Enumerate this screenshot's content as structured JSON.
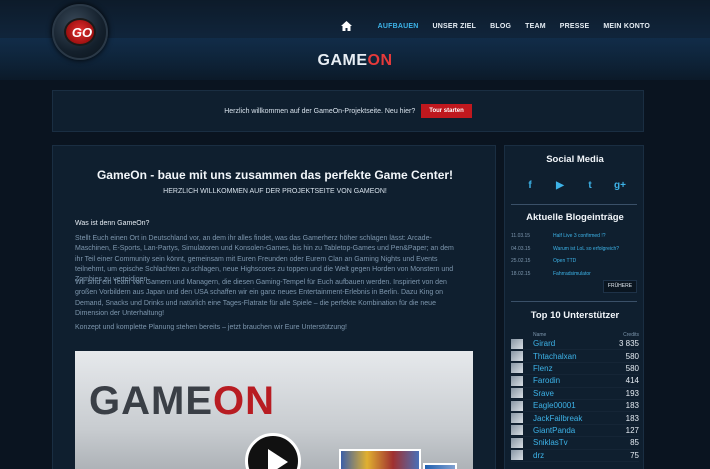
{
  "nav": {
    "items": [
      {
        "label": "AUFBAUEN",
        "active": true
      },
      {
        "label": "UNSER ZIEL",
        "active": false
      },
      {
        "label": "BLOG",
        "active": false
      },
      {
        "label": "TEAM",
        "active": false
      },
      {
        "label": "PRESSE",
        "active": false
      },
      {
        "label": "MEIN KONTO",
        "active": false
      }
    ]
  },
  "brand": {
    "part1": "GAME",
    "part2": "ON"
  },
  "logo": {
    "text": "GO"
  },
  "welcome": {
    "text": "Herzlich willkommen auf der GameOn-Projektseite. Neu hier?",
    "button": "Tour starten"
  },
  "main": {
    "title": "GameOn - baue mit uns zusammen das perfekte Game Center!",
    "subtitle": "HERZLICH WILLKOMMEN AUF DER PROJEKTSEITE VON GAMEON!",
    "section_heading": "Was ist denn GameOn?",
    "paragraphs": [
      "Stellt Euch einen Ort in Deutschland vor, an dem ihr alles findet, was das Gamerherz höher schlagen lässt: Arcade-Maschinen, E-Sports, Lan-Partys, Simulatoren und Konsolen-Games, bis hin zu Tabletop-Games und Pen&Paper; an dem ihr Teil einer Community sein könnt, gemeinsam mit Euren Freunden oder Eurem Clan an Gaming Nights und Events teilnehmt, um epische Schlachten zu schlagen, neue Highscores zu toppen und die Welt gegen Horden von Monstern und Zombies zu verteidigen.",
      "Wir sind ein Team von Gamern und Managern, die diesen Gaming-Tempel für Euch aufbauen werden. Inspiriert von den großen Vorbildern aus Japan und den USA schaffen wir ein ganz neues Entertainment-Erlebnis in Berlin. Dazu King on Demand, Snacks und Drinks und natürlich eine Tages-Flatrate für alle Spiele – die perfekte Kombination für die neue Dimension der Unterhaltung!",
      "Konzept und komplette Planung stehen bereits – jetzt brauchen wir Eure Unterstützung!"
    ],
    "video_logo": {
      "part1": "GAME",
      "part2": "ON"
    }
  },
  "sidebar": {
    "social_title": "Social Media",
    "social": [
      {
        "icon": "facebook-icon",
        "glyph": "f"
      },
      {
        "icon": "youtube-icon",
        "glyph": "▶"
      },
      {
        "icon": "twitter-icon",
        "glyph": "t"
      },
      {
        "icon": "google-plus-icon",
        "glyph": "g+"
      }
    ],
    "blog_title": "Aktuelle Blogeinträge",
    "blog": [
      {
        "date": "11.03.15",
        "title": "Half Live 3 confirmed !?"
      },
      {
        "date": "04.03.15",
        "title": "Warum ist LoL so erfolgreich?"
      },
      {
        "date": "25.02.15",
        "title": "Open TTD"
      },
      {
        "date": "18.02.15",
        "title": "Fahrradsimulator"
      }
    ],
    "older_button": "FRÜHERE",
    "top_title": "Top 10 Unterstützer",
    "top_header_name": "Name",
    "top_header_credits": "Credits",
    "top": [
      {
        "name": "Girard",
        "credits": "3 835"
      },
      {
        "name": "Thtachalxan",
        "credits": "580"
      },
      {
        "name": "Flenz",
        "credits": "580"
      },
      {
        "name": "Farodin",
        "credits": "414"
      },
      {
        "name": "Srave",
        "credits": "193"
      },
      {
        "name": "Eagle00001",
        "credits": "183"
      },
      {
        "name": "JackFailbreak",
        "credits": "183"
      },
      {
        "name": "GiantPanda",
        "credits": "127"
      },
      {
        "name": "SniklasTv",
        "credits": "85"
      },
      {
        "name": "drz",
        "credits": "75"
      }
    ]
  },
  "colors": {
    "accent": "#3db3e8",
    "brand_red": "#c0181e",
    "panel": "#0f1f2f"
  }
}
